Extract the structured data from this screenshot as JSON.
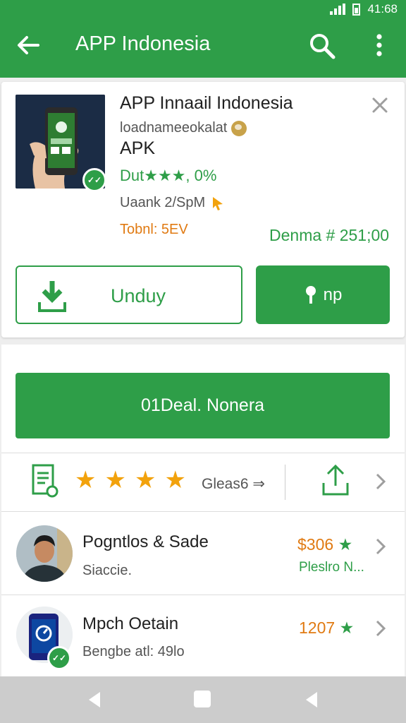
{
  "status_bar": {
    "time": "41:68"
  },
  "app_bar": {
    "title": "APP Indonesia"
  },
  "app_card": {
    "name": "APP Innaail Indonesia",
    "developer": "loadnameeokalat",
    "type": "APK",
    "rating_text": "Dut★★★, 0%",
    "size_text": "Uaank 2/SpM",
    "total_text": "Tobnl: 5EV",
    "demo_text": "Denma # 251;00",
    "download_label": "Unduy",
    "secondary_label": "np"
  },
  "main_button": {
    "label": "01Deal. Nonera"
  },
  "rating_row": {
    "stars": 4,
    "reviews_label": "Gleas6"
  },
  "list": [
    {
      "title": "Pogntlos & Sade",
      "subtitle": "Siaccie.",
      "price": "$306",
      "extra": "Pleslro N..."
    },
    {
      "title": "Mpch Oetain",
      "subtitle": "Bengbe atl: 49lo",
      "price": "1207",
      "extra": ""
    }
  ],
  "colors": {
    "brand_green": "#2e9e48",
    "accent_orange": "#e07a12",
    "star_gold": "#f2a20c"
  }
}
